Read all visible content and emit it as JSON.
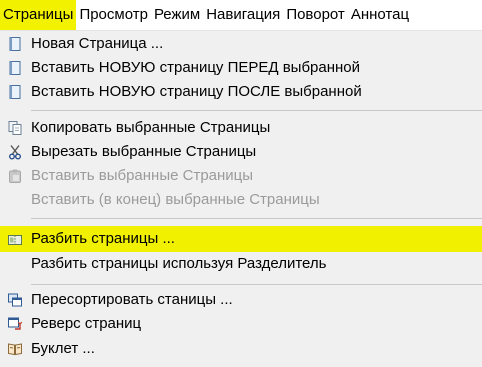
{
  "menubar": {
    "items": [
      {
        "label": "Страницы",
        "active": true
      },
      {
        "label": "Просмотр"
      },
      {
        "label": "Режим"
      },
      {
        "label": "Навигация"
      },
      {
        "label": "Поворот"
      },
      {
        "label": "Аннотац"
      }
    ]
  },
  "menu": {
    "items": [
      {
        "label": "Новая Страница ...",
        "icon": "page-icon"
      },
      {
        "label": "Вставить НОВУЮ страницу ПЕРЕД выбранной",
        "icon": "page-icon"
      },
      {
        "label": "Вставить НОВУЮ страницу ПОСЛЕ выбранной",
        "icon": "page-icon"
      },
      {
        "label": "Копировать выбранные Страницы",
        "icon": "copy-icon"
      },
      {
        "label": "Вырезать выбранные Страницы",
        "icon": "scissors-icon"
      },
      {
        "label": "Вставить выбранные Страницы",
        "icon": "paste-icon",
        "disabled": true
      },
      {
        "label": "Вставить (в конец) выбранные Страницы",
        "disabled": true
      },
      {
        "label": "Разбить страницы ...",
        "icon": "split-icon",
        "highlighted": true
      },
      {
        "label": "Разбить страницы используя Разделитель"
      },
      {
        "label": "Пересортировать станицы ...",
        "icon": "reorder-icon"
      },
      {
        "label": "Реверс страниц",
        "icon": "reverse-icon"
      },
      {
        "label": "Буклет ...",
        "icon": "booklet-icon"
      }
    ]
  },
  "colors": {
    "highlight": "#f0f000",
    "menubar_active": "#f2f200",
    "disabled_text": "#9b9b9b",
    "menu_background": "#f0f0f0"
  }
}
